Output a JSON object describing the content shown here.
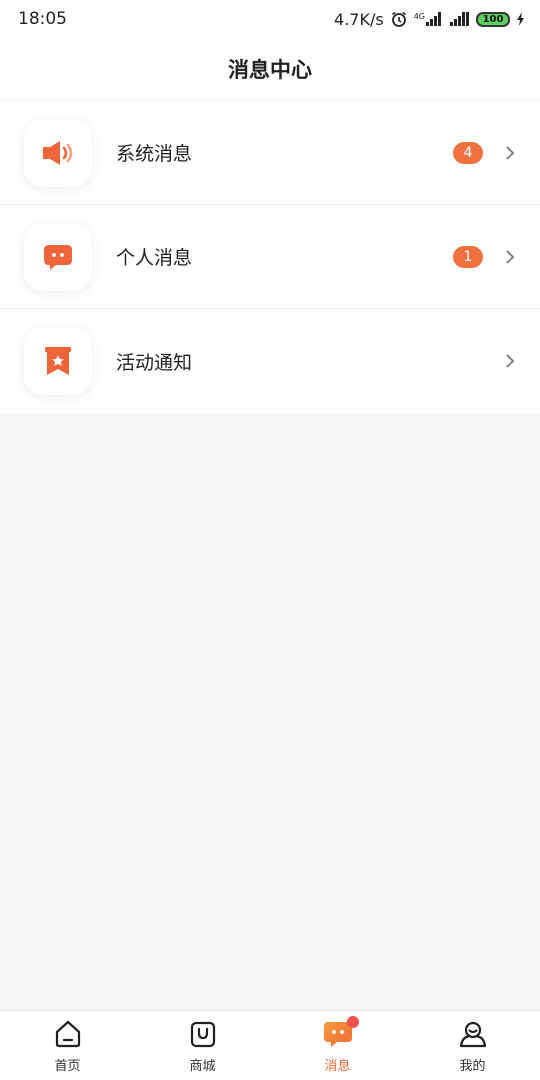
{
  "status_bar": {
    "time": "18:05",
    "speed": "4.7K/s",
    "network": "4G",
    "battery": "100",
    "icons": [
      "alarm-icon",
      "signal-icon",
      "signal-icon",
      "battery-icon",
      "charging-icon"
    ]
  },
  "header": {
    "title": "消息中心"
  },
  "messages": [
    {
      "label": "系统消息",
      "badge": "4",
      "icon": "speaker-icon"
    },
    {
      "label": "个人消息",
      "badge": "1",
      "icon": "chat-bubble-icon"
    },
    {
      "label": "活动通知",
      "badge": "",
      "icon": "ribbon-star-icon"
    }
  ],
  "tabs": [
    {
      "label": "首页",
      "icon": "home-icon"
    },
    {
      "label": "商城",
      "icon": "shopping-bag-icon"
    },
    {
      "label": "消息",
      "icon": "message-icon",
      "active": true
    },
    {
      "label": "我的",
      "icon": "user-icon"
    }
  ],
  "colors": {
    "accent": "#f06a35",
    "badge": "#f07040",
    "dot": "#f0504d"
  }
}
